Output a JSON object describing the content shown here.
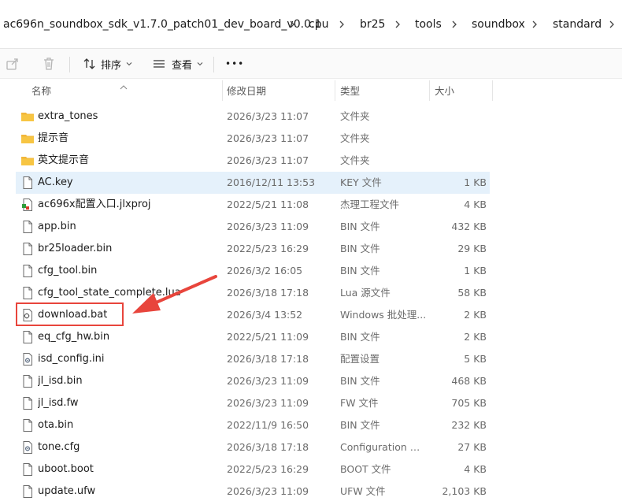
{
  "breadcrumb": {
    "items": [
      "ac696n_soundbox_sdk_v1.7.0_patch01_dev_board_v0.0.1",
      "cpu",
      "br25",
      "tools",
      "soundbox",
      "standard"
    ]
  },
  "toolbar": {
    "sort_label": "排序",
    "view_label": "查看",
    "more_label": "•••"
  },
  "columns": {
    "name": "名称",
    "date": "修改日期",
    "type": "类型",
    "size": "大小"
  },
  "files": [
    {
      "name": "extra_tones",
      "date": "2026/3/23 11:07",
      "type": "文件夹",
      "size": "",
      "icon": "folder-icon"
    },
    {
      "name": "提示音",
      "date": "2026/3/23 11:07",
      "type": "文件夹",
      "size": "",
      "icon": "folder-icon"
    },
    {
      "name": "英文提示音",
      "date": "2026/3/23 11:07",
      "type": "文件夹",
      "size": "",
      "icon": "folder-icon"
    },
    {
      "name": "AC.key",
      "date": "2016/12/11 13:53",
      "type": "KEY 文件",
      "size": "1 KB",
      "icon": "file-icon",
      "selected": true
    },
    {
      "name": "ac696x配置入口.jlxproj",
      "date": "2022/5/21 11:08",
      "type": "杰理工程文件",
      "size": "4 KB",
      "icon": "project-file-icon"
    },
    {
      "name": "app.bin",
      "date": "2026/3/23 11:09",
      "type": "BIN 文件",
      "size": "432 KB",
      "icon": "file-icon"
    },
    {
      "name": "br25loader.bin",
      "date": "2022/5/23 16:29",
      "type": "BIN 文件",
      "size": "29 KB",
      "icon": "file-icon"
    },
    {
      "name": "cfg_tool.bin",
      "date": "2026/3/2 16:05",
      "type": "BIN 文件",
      "size": "1 KB",
      "icon": "file-icon"
    },
    {
      "name": "cfg_tool_state_complete.lua",
      "date": "2026/3/18 17:18",
      "type": "Lua 源文件",
      "size": "58 KB",
      "icon": "file-icon"
    },
    {
      "name": "download.bat",
      "date": "2026/3/4 13:52",
      "type": "Windows 批处理...",
      "size": "2 KB",
      "icon": "batch-file-icon"
    },
    {
      "name": "eq_cfg_hw.bin",
      "date": "2022/5/21 11:09",
      "type": "BIN 文件",
      "size": "2 KB",
      "icon": "file-icon"
    },
    {
      "name": "isd_config.ini",
      "date": "2026/3/18 17:18",
      "type": "配置设置",
      "size": "5 KB",
      "icon": "config-file-icon"
    },
    {
      "name": "jl_isd.bin",
      "date": "2026/3/23 11:09",
      "type": "BIN 文件",
      "size": "468 KB",
      "icon": "file-icon"
    },
    {
      "name": "jl_isd.fw",
      "date": "2026/3/23 11:09",
      "type": "FW 文件",
      "size": "705 KB",
      "icon": "file-icon"
    },
    {
      "name": "ota.bin",
      "date": "2022/11/9 16:50",
      "type": "BIN 文件",
      "size": "232 KB",
      "icon": "file-icon"
    },
    {
      "name": "tone.cfg",
      "date": "2026/3/18 17:18",
      "type": "Configuration 源...",
      "size": "27 KB",
      "icon": "config-file-icon"
    },
    {
      "name": "uboot.boot",
      "date": "2022/5/23 16:29",
      "type": "BOOT 文件",
      "size": "4 KB",
      "icon": "file-icon"
    },
    {
      "name": "update.ufw",
      "date": "2026/3/23 11:09",
      "type": "UFW 文件",
      "size": "2,103 KB",
      "icon": "file-icon"
    }
  ],
  "colors": {
    "selection": "#e5f1fb",
    "folder": "#f7c543",
    "annotation": "#e8453c"
  }
}
